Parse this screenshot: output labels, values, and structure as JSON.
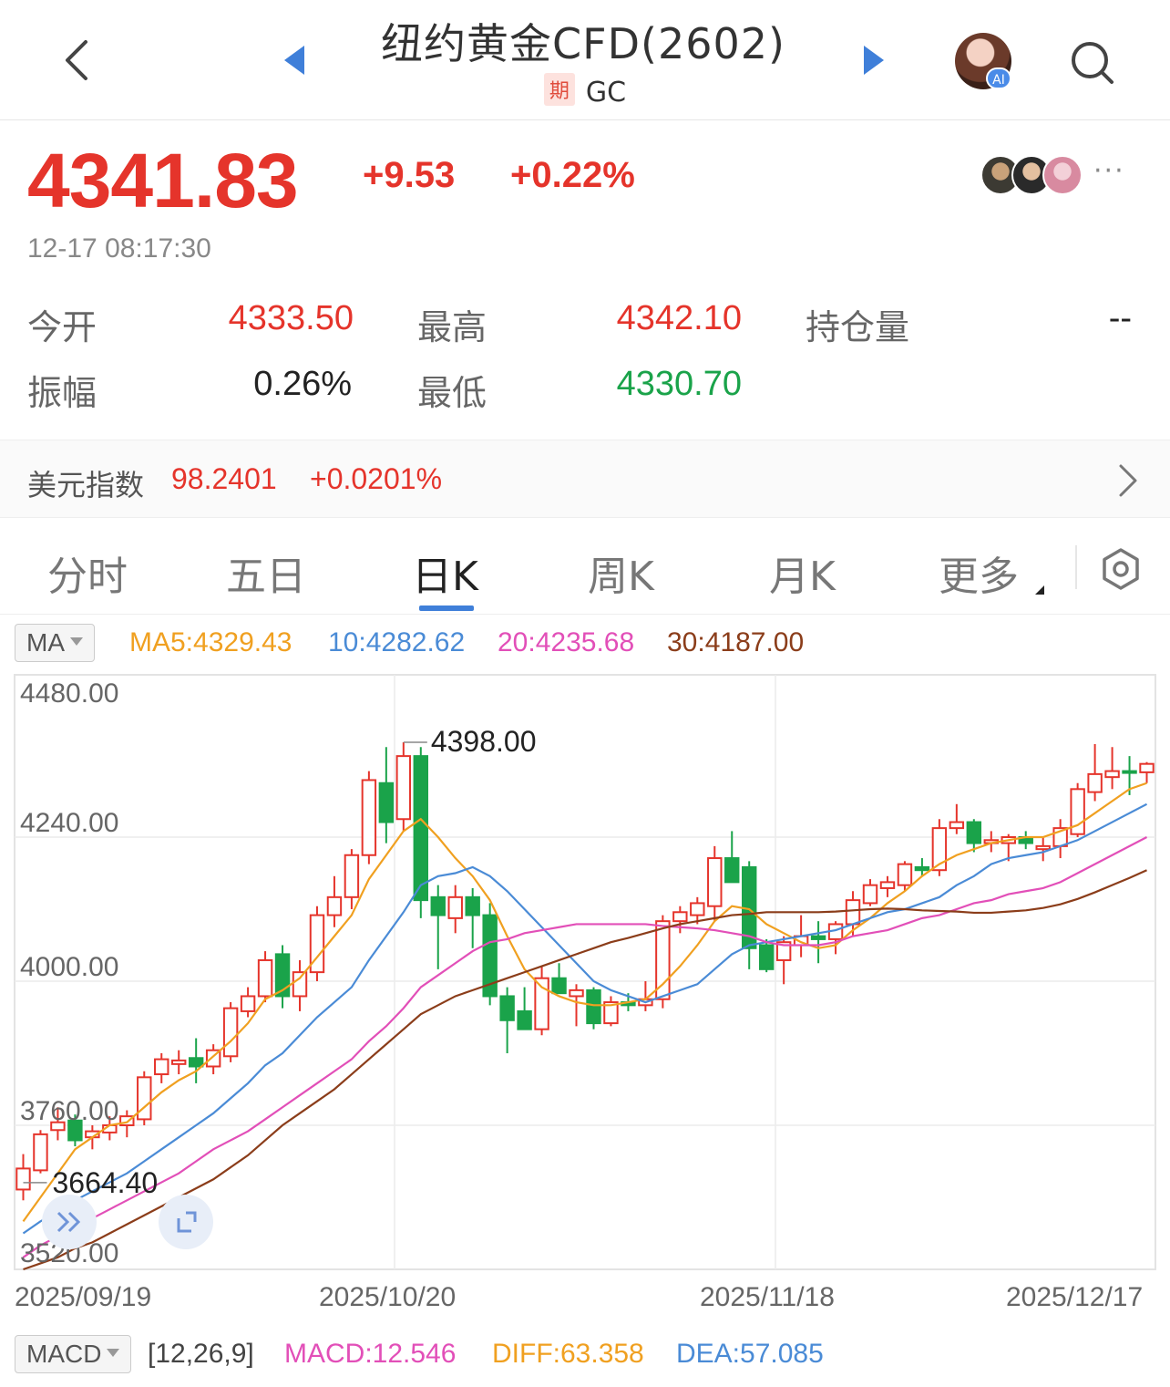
{
  "header": {
    "title": "纽约黄金CFD(2602)",
    "badge": "期",
    "code": "GC",
    "ai_badge": "AI"
  },
  "quote": {
    "price": "4341.83",
    "change": "+9.53",
    "change_pct": "+0.22%",
    "time": "12-17 08:17:30",
    "more": "···"
  },
  "stats": {
    "open_label": "今开",
    "open_value": "4333.50",
    "high_label": "最高",
    "high_value": "4342.10",
    "oi_label": "持仓量",
    "oi_value": "--",
    "amp_label": "振幅",
    "amp_value": "0.26%",
    "low_label": "最低",
    "low_value": "4330.70"
  },
  "usd_index": {
    "label": "美元指数",
    "value": "98.2401",
    "change": "+0.0201%"
  },
  "tabs": [
    "分时",
    "五日",
    "日K",
    "周K",
    "月K",
    "更多"
  ],
  "active_tab": "日K",
  "ma_legend": {
    "selector": "MA",
    "ma5": "MA5:4329.43",
    "ma10": "10:4282.62",
    "ma20": "20:4235.68",
    "ma30": "30:4187.00"
  },
  "macd_legend": {
    "selector": "MACD",
    "params": "[12,26,9]",
    "macd": "MACD:12.546",
    "diff": "DIFF:63.358",
    "dea": "DEA:57.085"
  },
  "colors": {
    "up": "#e5342b",
    "down": "#1aa34a",
    "accent": "#3f7fd9",
    "ma5": "#f0a020",
    "ma10": "#4a8bd6",
    "ma20": "#e24fb8",
    "ma30": "#8b3d1a"
  },
  "chart_data": {
    "type": "candlestick",
    "y_ticks": [
      "4480.00",
      "4240.00",
      "4000.00",
      "3760.00",
      "3520.00"
    ],
    "ylim": [
      3520,
      4480
    ],
    "x_ticks": [
      "2025/09/19",
      "2025/10/20",
      "2025/11/18",
      "2025/12/17"
    ],
    "max_label": "4398.00",
    "min_label": "3664.40",
    "candles": [
      {
        "o": 3653,
        "h": 3712,
        "l": 3635,
        "c": 3688
      },
      {
        "o": 3685,
        "h": 3752,
        "l": 3680,
        "c": 3745
      },
      {
        "o": 3752,
        "h": 3790,
        "l": 3735,
        "c": 3765
      },
      {
        "o": 3768,
        "h": 3778,
        "l": 3725,
        "c": 3735
      },
      {
        "o": 3740,
        "h": 3760,
        "l": 3720,
        "c": 3750
      },
      {
        "o": 3748,
        "h": 3775,
        "l": 3735,
        "c": 3760
      },
      {
        "o": 3760,
        "h": 3785,
        "l": 3740,
        "c": 3775
      },
      {
        "o": 3770,
        "h": 3850,
        "l": 3760,
        "c": 3840
      },
      {
        "o": 3845,
        "h": 3880,
        "l": 3830,
        "c": 3870
      },
      {
        "o": 3862,
        "h": 3885,
        "l": 3845,
        "c": 3868
      },
      {
        "o": 3872,
        "h": 3905,
        "l": 3830,
        "c": 3858
      },
      {
        "o": 3858,
        "h": 3895,
        "l": 3845,
        "c": 3885
      },
      {
        "o": 3875,
        "h": 3965,
        "l": 3865,
        "c": 3955
      },
      {
        "o": 3950,
        "h": 3990,
        "l": 3940,
        "c": 3975
      },
      {
        "o": 3975,
        "h": 4050,
        "l": 3965,
        "c": 4035
      },
      {
        "o": 4045,
        "h": 4060,
        "l": 3955,
        "c": 3975
      },
      {
        "o": 3975,
        "h": 4035,
        "l": 3950,
        "c": 4015
      },
      {
        "o": 4015,
        "h": 4125,
        "l": 4000,
        "c": 4110
      },
      {
        "o": 4110,
        "h": 4175,
        "l": 4090,
        "c": 4140
      },
      {
        "o": 4140,
        "h": 4220,
        "l": 4120,
        "c": 4210
      },
      {
        "o": 4210,
        "h": 4350,
        "l": 4195,
        "c": 4335
      },
      {
        "o": 4330,
        "h": 4390,
        "l": 4230,
        "c": 4265
      },
      {
        "o": 4270,
        "h": 4398,
        "l": 4250,
        "c": 4375
      },
      {
        "o": 4375,
        "h": 4390,
        "l": 4105,
        "c": 4135
      },
      {
        "o": 4140,
        "h": 4160,
        "l": 4020,
        "c": 4110
      },
      {
        "o": 4105,
        "h": 4160,
        "l": 4080,
        "c": 4140
      },
      {
        "o": 4140,
        "h": 4155,
        "l": 4055,
        "c": 4110
      },
      {
        "o": 4110,
        "h": 4130,
        "l": 3960,
        "c": 3975
      },
      {
        "o": 3975,
        "h": 3990,
        "l": 3880,
        "c": 3935
      },
      {
        "o": 3950,
        "h": 3990,
        "l": 3925,
        "c": 3920
      },
      {
        "o": 3920,
        "h": 4025,
        "l": 3910,
        "c": 4005
      },
      {
        "o": 4005,
        "h": 4030,
        "l": 3980,
        "c": 3980
      },
      {
        "o": 3975,
        "h": 3995,
        "l": 3925,
        "c": 3985
      },
      {
        "o": 3985,
        "h": 3990,
        "l": 3920,
        "c": 3930
      },
      {
        "o": 3930,
        "h": 3975,
        "l": 3925,
        "c": 3965
      },
      {
        "o": 3965,
        "h": 3980,
        "l": 3950,
        "c": 3960
      },
      {
        "o": 3960,
        "h": 4000,
        "l": 3950,
        "c": 3970
      },
      {
        "o": 3970,
        "h": 4110,
        "l": 3955,
        "c": 4100
      },
      {
        "o": 4100,
        "h": 4125,
        "l": 4080,
        "c": 4115
      },
      {
        "o": 4110,
        "h": 4140,
        "l": 4095,
        "c": 4130
      },
      {
        "o": 4125,
        "h": 4225,
        "l": 4100,
        "c": 4205
      },
      {
        "o": 4205,
        "h": 4250,
        "l": 4175,
        "c": 4165
      },
      {
        "o": 4190,
        "h": 4200,
        "l": 4020,
        "c": 4055
      },
      {
        "o": 4060,
        "h": 4070,
        "l": 4015,
        "c": 4020
      },
      {
        "o": 4035,
        "h": 4075,
        "l": 3995,
        "c": 4065
      },
      {
        "o": 4060,
        "h": 4110,
        "l": 4040,
        "c": 4075
      },
      {
        "o": 4075,
        "h": 4100,
        "l": 4030,
        "c": 4070
      },
      {
        "o": 4070,
        "h": 4100,
        "l": 4045,
        "c": 4095
      },
      {
        "o": 4095,
        "h": 4150,
        "l": 4075,
        "c": 4135
      },
      {
        "o": 4130,
        "h": 4170,
        "l": 4125,
        "c": 4160
      },
      {
        "o": 4155,
        "h": 4175,
        "l": 4140,
        "c": 4165
      },
      {
        "o": 4160,
        "h": 4200,
        "l": 4150,
        "c": 4195
      },
      {
        "o": 4190,
        "h": 4205,
        "l": 4175,
        "c": 4185
      },
      {
        "o": 4185,
        "h": 4270,
        "l": 4175,
        "c": 4255
      },
      {
        "o": 4255,
        "h": 4295,
        "l": 4245,
        "c": 4265
      },
      {
        "o": 4265,
        "h": 4270,
        "l": 4215,
        "c": 4230
      },
      {
        "o": 4230,
        "h": 4250,
        "l": 4215,
        "c": 4235
      },
      {
        "o": 4230,
        "h": 4245,
        "l": 4200,
        "c": 4240
      },
      {
        "o": 4240,
        "h": 4250,
        "l": 4220,
        "c": 4230
      },
      {
        "o": 4220,
        "h": 4240,
        "l": 4200,
        "c": 4225
      },
      {
        "o": 4225,
        "h": 4270,
        "l": 4205,
        "c": 4255
      },
      {
        "o": 4245,
        "h": 4330,
        "l": 4240,
        "c": 4320
      },
      {
        "o": 4315,
        "h": 4395,
        "l": 4300,
        "c": 4345
      },
      {
        "o": 4340,
        "h": 4390,
        "l": 4320,
        "c": 4350
      },
      {
        "o": 4350,
        "h": 4375,
        "l": 4310,
        "c": 4348
      },
      {
        "o": 4348,
        "h": 4365,
        "l": 4330,
        "c": 4362
      }
    ],
    "series": [
      {
        "values": [
          3600,
          3640,
          3680,
          3720,
          3740,
          3760,
          3765,
          3790,
          3815,
          3835,
          3850,
          3875,
          3900,
          3930,
          3970,
          3985,
          4005,
          4040,
          4075,
          4110,
          4170,
          4210,
          4250,
          4270,
          4240,
          4205,
          4175,
          4135,
          4075,
          4020,
          3990,
          3975,
          3965,
          3960,
          3960,
          3965,
          3970,
          3995,
          4025,
          4060,
          4100,
          4125,
          4120,
          4095,
          4080,
          4065,
          4055,
          4060,
          4085,
          4105,
          4130,
          4150,
          4175,
          4195,
          4210,
          4220,
          4230,
          4235,
          4240,
          4240,
          4250,
          4260,
          4280,
          4300,
          4320,
          4330
        ]
      },
      {
        "values": [
          3580,
          3600,
          3615,
          3635,
          3650,
          3665,
          3680,
          3700,
          3720,
          3740,
          3760,
          3780,
          3805,
          3830,
          3860,
          3880,
          3910,
          3940,
          3965,
          3990,
          4035,
          4075,
          4115,
          4160,
          4175,
          4180,
          4190,
          4175,
          4150,
          4120,
          4090,
          4060,
          4030,
          4000,
          3985,
          3975,
          3965,
          3975,
          3985,
          3995,
          4020,
          4045,
          4060,
          4065,
          4070,
          4075,
          4080,
          4085,
          4095,
          4105,
          4115,
          4120,
          4130,
          4140,
          4160,
          4175,
          4195,
          4205,
          4210,
          4215,
          4225,
          4235,
          4250,
          4265,
          4280,
          4295
        ]
      },
      {
        "values": [
          3540,
          3560,
          3575,
          3590,
          3605,
          3620,
          3635,
          3650,
          3665,
          3680,
          3700,
          3720,
          3735,
          3750,
          3770,
          3790,
          3810,
          3830,
          3850,
          3870,
          3900,
          3925,
          3955,
          3990,
          4010,
          4030,
          4050,
          4065,
          4070,
          4080,
          4085,
          4090,
          4095,
          4095,
          4095,
          4095,
          4095,
          4092,
          4090,
          4088,
          4085,
          4080,
          4075,
          4065,
          4060,
          4060,
          4060,
          4065,
          4075,
          4080,
          4085,
          4095,
          4105,
          4110,
          4120,
          4130,
          4135,
          4145,
          4150,
          4155,
          4165,
          4180,
          4195,
          4210,
          4225,
          4240
        ]
      },
      {
        "values": [
          3520,
          3530,
          3540,
          3555,
          3565,
          3580,
          3595,
          3610,
          3625,
          3640,
          3655,
          3670,
          3690,
          3710,
          3735,
          3760,
          3780,
          3800,
          3820,
          3845,
          3870,
          3895,
          3920,
          3945,
          3960,
          3975,
          3985,
          3995,
          4005,
          4015,
          4025,
          4035,
          4045,
          4055,
          4065,
          4072,
          4080,
          4088,
          4095,
          4100,
          4105,
          4110,
          4112,
          4115,
          4115,
          4115,
          4115,
          4116,
          4118,
          4120,
          4121,
          4120,
          4118,
          4117,
          4116,
          4114,
          4114,
          4116,
          4118,
          4122,
          4128,
          4137,
          4148,
          4160,
          4172,
          4185
        ]
      }
    ]
  }
}
